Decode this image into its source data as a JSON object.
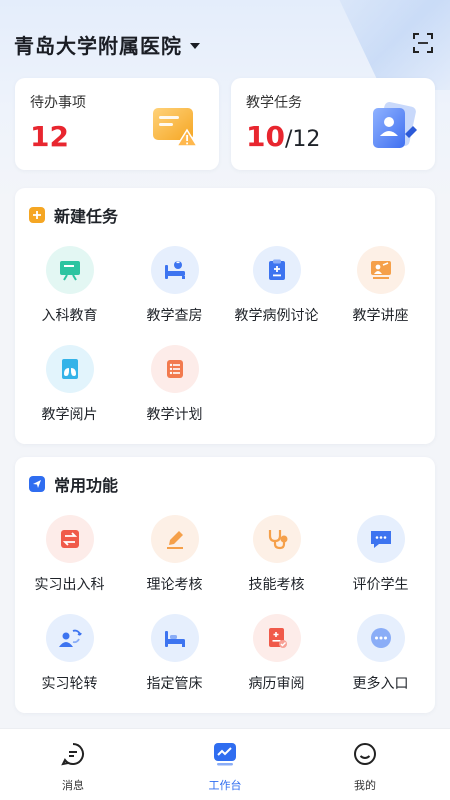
{
  "header": {
    "hospital_name": "青岛大学附属医院"
  },
  "stats": {
    "todo": {
      "label": "待办事项",
      "count": "12"
    },
    "teaching": {
      "label": "教学任务",
      "done": "10",
      "total": "/12"
    }
  },
  "new_task": {
    "title": "新建任务",
    "items": [
      {
        "label": "入科教育",
        "icon": "whiteboard-icon"
      },
      {
        "label": "教学查房",
        "icon": "hospital-bed-nurse-icon"
      },
      {
        "label": "教学病例讨论",
        "icon": "clipboard-plus-icon"
      },
      {
        "label": "教学讲座",
        "icon": "lecture-icon"
      },
      {
        "label": "教学阅片",
        "icon": "lungs-film-icon"
      },
      {
        "label": "教学计划",
        "icon": "plan-list-icon"
      }
    ]
  },
  "common": {
    "title": "常用功能",
    "items": [
      {
        "label": "实习出入科",
        "icon": "transfer-icon"
      },
      {
        "label": "理论考核",
        "icon": "edit-paper-icon"
      },
      {
        "label": "技能考核",
        "icon": "stethoscope-icon"
      },
      {
        "label": "评价学生",
        "icon": "chat-bubble-icon"
      },
      {
        "label": "实习轮转",
        "icon": "rotation-users-icon"
      },
      {
        "label": "指定管床",
        "icon": "bed-icon"
      },
      {
        "label": "病历审阅",
        "icon": "medical-record-icon"
      },
      {
        "label": "更多入口",
        "icon": "more-icon"
      }
    ]
  },
  "tabbar": {
    "messages": "消息",
    "workbench": "工作台",
    "mine": "我的"
  },
  "colors": {
    "accent": "#2f6df0",
    "alert": "#e8262f",
    "orange": "#f5a623"
  }
}
